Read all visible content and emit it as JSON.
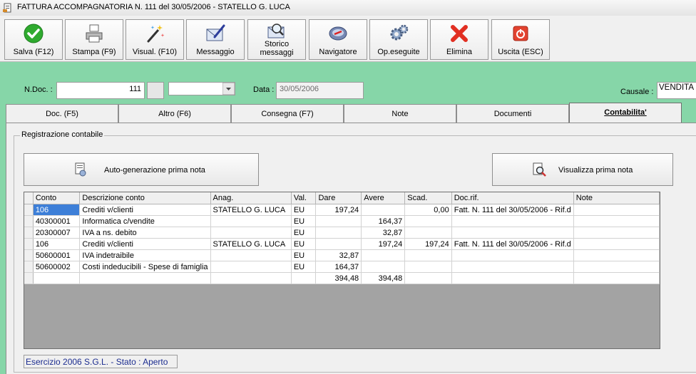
{
  "window": {
    "title": "FATTURA ACCOMPAGNATORIA N. 111  del 30/05/2006 - STATELLO G. LUCA"
  },
  "toolbar": {
    "buttons": [
      {
        "label": "Salva (F12)",
        "icon": "check-icon"
      },
      {
        "label": "Stampa (F9)",
        "icon": "printer-icon"
      },
      {
        "label": "Visual. (F10)",
        "icon": "magic-wand-icon"
      },
      {
        "label": "Messaggio",
        "icon": "envelope-pen-icon"
      },
      {
        "label": "Storico messaggi",
        "icon": "envelope-search-icon"
      },
      {
        "label": "Navigatore",
        "icon": "compass-icon"
      },
      {
        "label": "Op.eseguite",
        "icon": "gears-icon"
      },
      {
        "label": "Elimina",
        "icon": "delete-x-icon"
      },
      {
        "label": "Uscita (ESC)",
        "icon": "power-icon"
      }
    ]
  },
  "header": {
    "ndoc_label": "N.Doc. :",
    "ndoc_value": "111",
    "data_label": "Data :",
    "data_value": "30/05/2006",
    "causale_label": "Causale :",
    "causale_value": "VENDITA"
  },
  "tabs": [
    {
      "label": "Doc. (F5)"
    },
    {
      "label": "Altro (F6)"
    },
    {
      "label": "Consegna (F7)"
    },
    {
      "label": "Note"
    },
    {
      "label": "Documenti"
    },
    {
      "label": "Contabilita'",
      "active": true
    }
  ],
  "contabilita": {
    "group_label": "Registrazione contabile",
    "autogen_label": "Auto-generazione prima nota",
    "visualizza_label": "Visualizza prima nota",
    "columns": [
      "Conto",
      "Descrizione conto",
      "Anag.",
      "Val.",
      "Dare",
      "Avere",
      "Scad.",
      "Doc.rif.",
      "Note"
    ],
    "rows": [
      [
        "106",
        "Crediti v/clienti",
        "STATELLO G. LUCA",
        "EU",
        "197,24",
        "",
        "0,00",
        "Fatt. N. 111 del 30/05/2006 - Rif.d",
        ""
      ],
      [
        "40300001",
        "Informatica c/vendite",
        "",
        "EU",
        "",
        "164,37",
        "",
        "",
        ""
      ],
      [
        "20300007",
        "IVA a ns. debito",
        "",
        "EU",
        "",
        "32,87",
        "",
        "",
        ""
      ],
      [
        "106",
        "Crediti v/clienti",
        "STATELLO G. LUCA",
        "EU",
        "",
        "197,24",
        "197,24",
        "Fatt. N. 111 del 30/05/2006 - Rif.d",
        ""
      ],
      [
        "50600001",
        "IVA indetraibile",
        "",
        "EU",
        "32,87",
        "",
        "",
        "",
        ""
      ],
      [
        "50600002",
        "Costi indeducibili - Spese di famiglia",
        "",
        "EU",
        "164,37",
        "",
        "",
        "",
        ""
      ],
      [
        "",
        "",
        "",
        "",
        "394,48",
        "394,48",
        "",
        "",
        ""
      ]
    ]
  },
  "status": {
    "text": "Esercizio 2006 S.G.L. - Stato : Aperto"
  },
  "colors": {
    "background_green": "#86d6a8",
    "selection_blue": "#3d7fd8",
    "status_text": "#1b2c8f"
  }
}
